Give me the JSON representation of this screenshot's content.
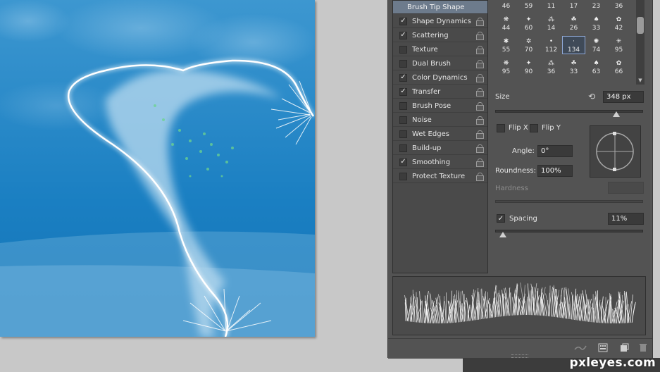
{
  "brush_options": [
    {
      "label": "Brush Tip Shape",
      "header": true
    },
    {
      "label": "Shape Dynamics",
      "checked": true
    },
    {
      "label": "Scattering",
      "checked": true
    },
    {
      "label": "Texture",
      "checked": false
    },
    {
      "label": "Dual Brush",
      "checked": false
    },
    {
      "label": "Color Dynamics",
      "checked": true
    },
    {
      "label": "Transfer",
      "checked": true
    },
    {
      "label": "Brush Pose",
      "checked": false
    },
    {
      "label": "Noise",
      "checked": false
    },
    {
      "label": "Wet Edges",
      "checked": false
    },
    {
      "label": "Build-up",
      "checked": false
    },
    {
      "label": "Smoothing",
      "checked": true
    },
    {
      "label": "Protect Texture",
      "checked": false
    }
  ],
  "presets": [
    [
      "46",
      "59",
      "11",
      "17",
      "23",
      "36"
    ],
    [
      "44",
      "60",
      "14",
      "26",
      "33",
      "42"
    ],
    [
      "55",
      "70",
      "112",
      "134",
      "74",
      "95"
    ],
    [
      "95",
      "90",
      "36",
      "33",
      "63",
      "66"
    ]
  ],
  "selected_preset": "134",
  "size": {
    "label": "Size",
    "value": "348 px",
    "slider_fraction": 0.82
  },
  "flip_x": {
    "label": "Flip X",
    "checked": false
  },
  "flip_y": {
    "label": "Flip Y",
    "checked": false
  },
  "angle": {
    "label": "Angle:",
    "value": "0°"
  },
  "roundness": {
    "label": "Roundness:",
    "value": "100%"
  },
  "hardness": {
    "label": "Hardness"
  },
  "spacing": {
    "label": "Spacing",
    "checked": true,
    "value": "11%",
    "slider_fraction": 0.05
  },
  "watermark": "pxleyes.com",
  "colors": {
    "panel": "#535353",
    "canvas_blue": "#1f7fc0",
    "selected_outline": "#8fa8d6"
  }
}
